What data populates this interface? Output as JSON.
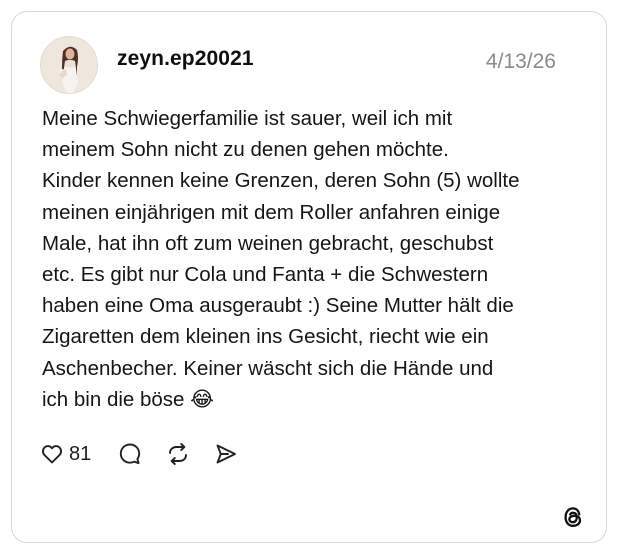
{
  "post": {
    "username": "zeyn.ep20021",
    "date": "4/13/26",
    "avatar_icon": "profile-photo",
    "text": "Meine Schwiegerfamilie ist sauer, weil ich mit\nmeinem Sohn nicht zu denen gehen möchte.\nKinder kennen keine Grenzen, deren Sohn (5) wollte\nmeinen einjährigen mit dem Roller anfahren einige\nMale, hat ihn oft zum weinen gebracht, geschubst\netc. Es gibt nur Cola und Fanta + die Schwestern\nhaben eine Oma ausgeraubt :) Seine Mutter hält die\nZigaretten dem kleinen ins Gesicht, riecht wie ein\nAschenbecher. Keiner wäscht sich die Hände und\nich bin die böse 😂"
  },
  "actions": {
    "like_count": "81",
    "like_icon": "heart-icon",
    "reply_icon": "comment-icon",
    "repost_icon": "repost-icon",
    "share_icon": "send-icon"
  },
  "branding": {
    "logo": "threads-logo"
  },
  "colors": {
    "text": "#161616",
    "muted": "#8a8a8a",
    "border": "#d8d8d8"
  }
}
